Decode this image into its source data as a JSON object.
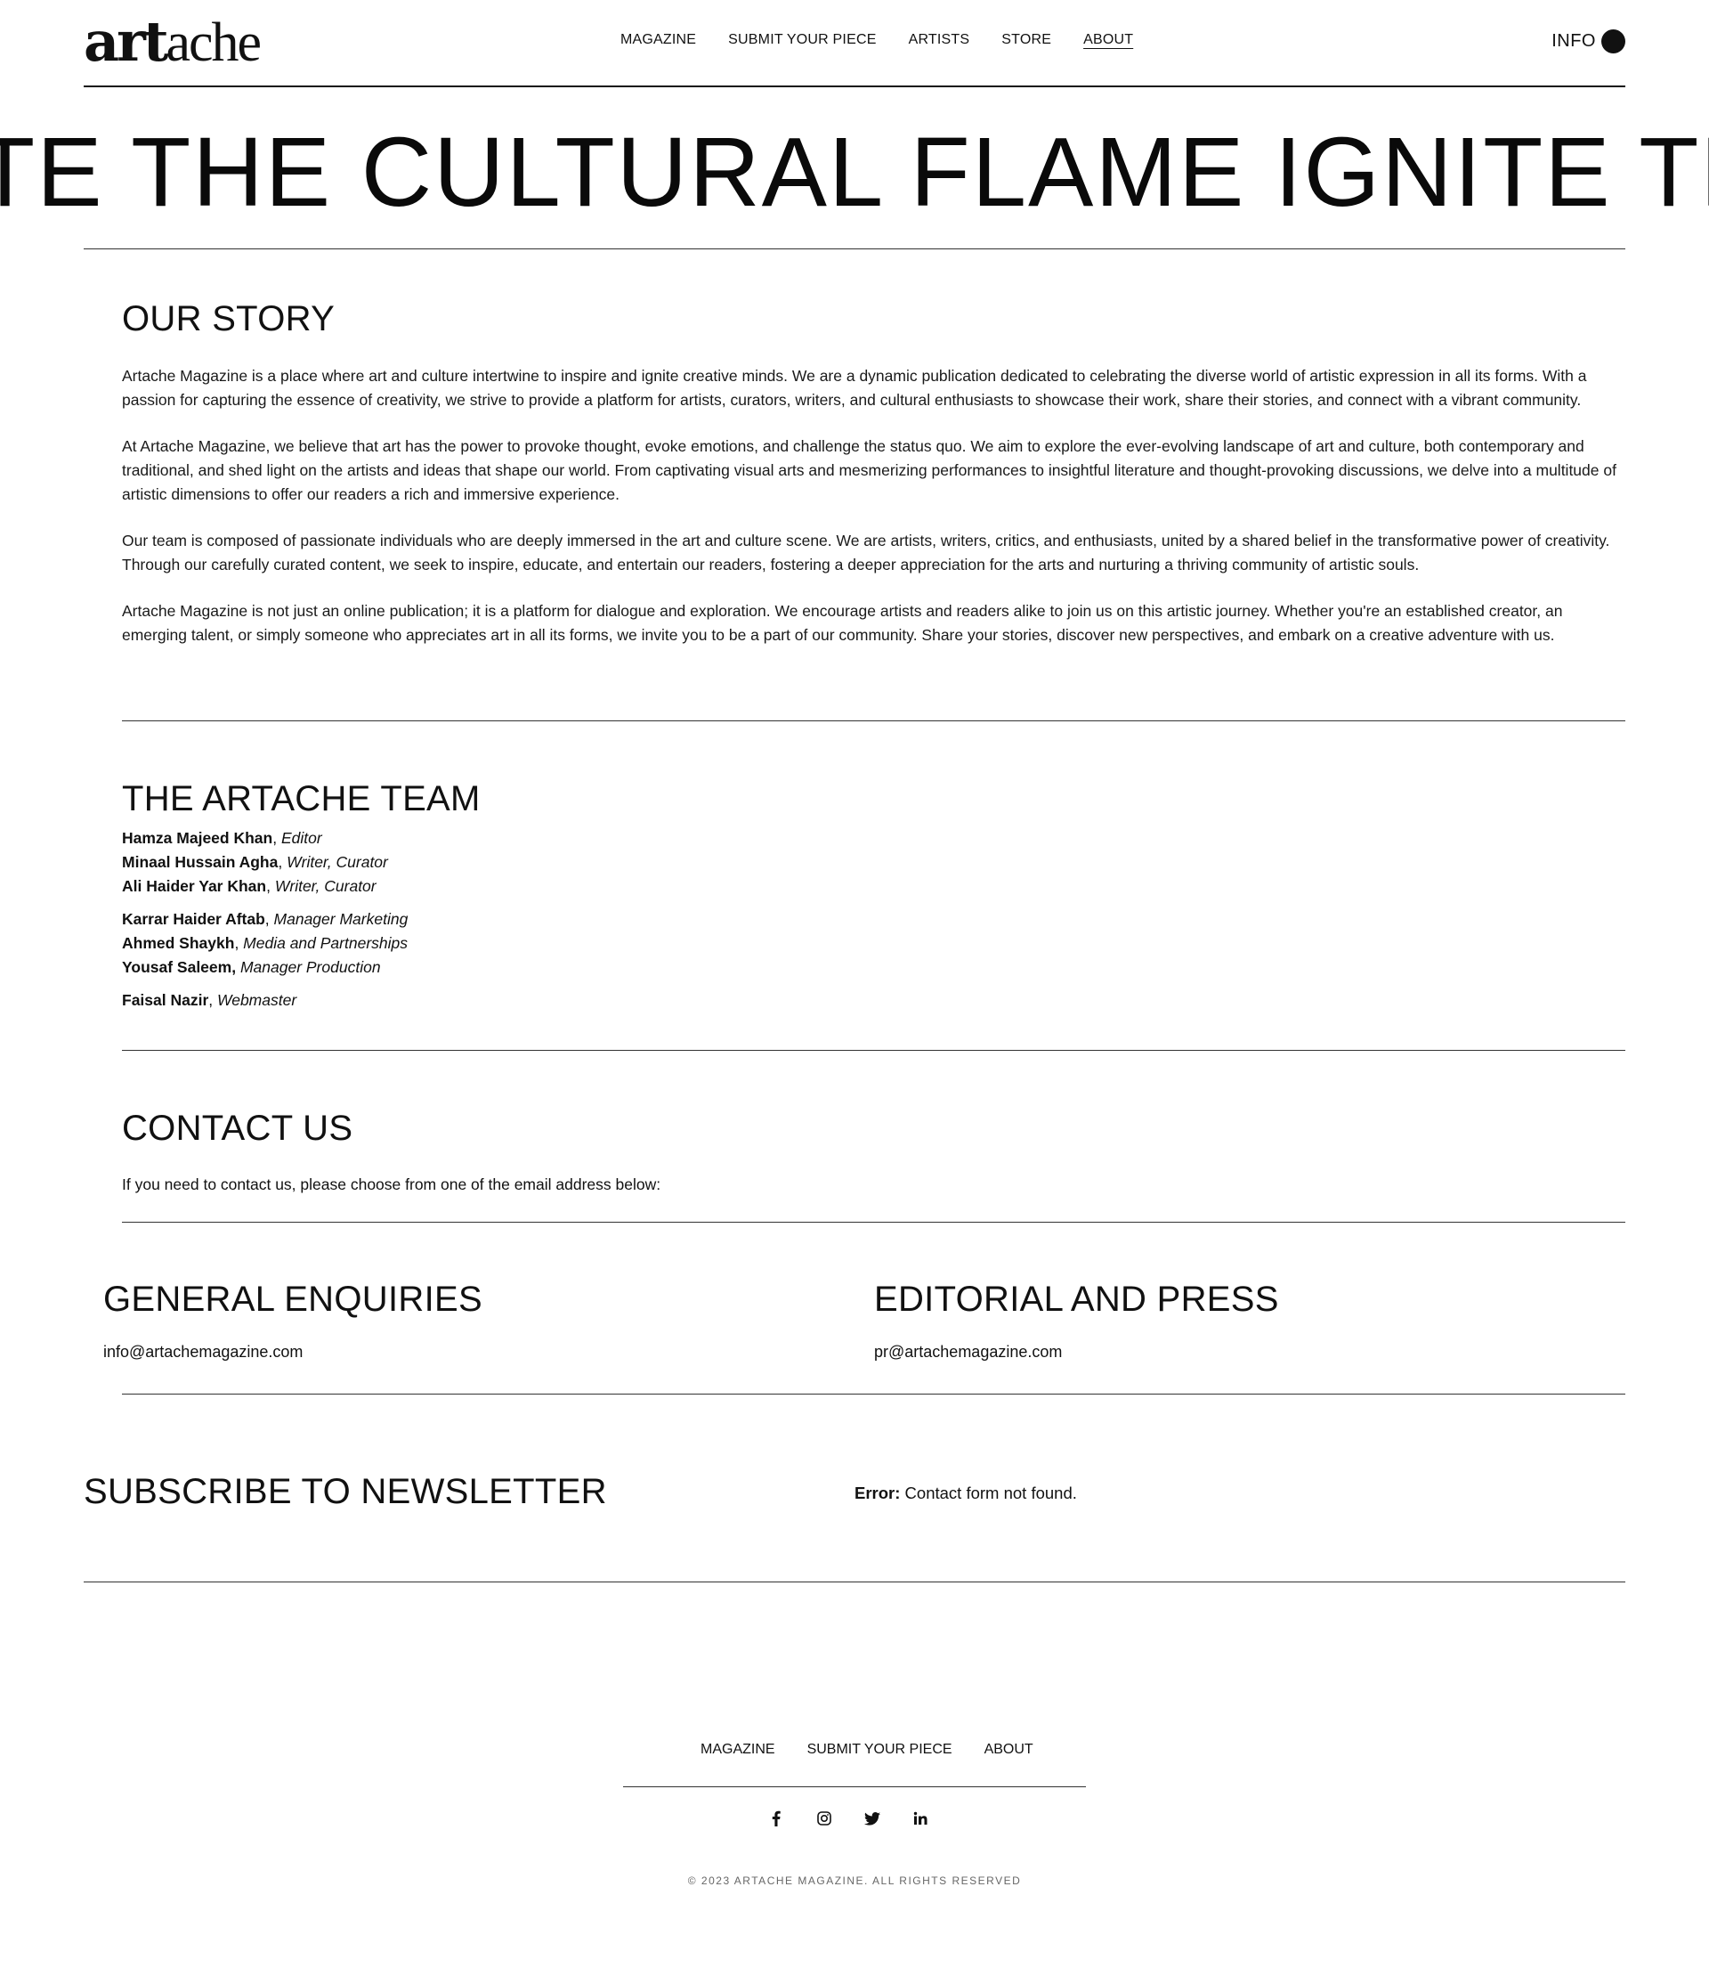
{
  "header": {
    "logo": {
      "part1": "art",
      "part2": "ache"
    },
    "nav": [
      {
        "label": "MAGAZINE"
      },
      {
        "label": "SUBMIT YOUR PIECE"
      },
      {
        "label": "ARTISTS"
      },
      {
        "label": "STORE"
      },
      {
        "label": "ABOUT",
        "active": true
      }
    ],
    "info_label": "INFO"
  },
  "marquee": {
    "text": "TE THE CULTURAL FLAME IGNITE THE A"
  },
  "story": {
    "title": "OUR STORY",
    "paragraphs": [
      "Artache Magazine is a place where art and culture intertwine to inspire and ignite creative minds. We are a dynamic publication dedicated to celebrating the diverse world of artistic expression in all its forms. With a passion for capturing the essence of creativity, we strive to provide a platform for artists, curators, writers, and cultural enthusiasts to showcase their work, share their stories, and connect with a vibrant community.",
      "At Artache Magazine, we believe that art has the power to provoke thought, evoke emotions, and challenge the status quo. We aim to explore the ever-evolving landscape of art and culture, both contemporary and traditional, and shed light on the artists and ideas that shape our world. From captivating visual arts and mesmerizing performances to insightful literature and thought-provoking discussions, we delve into a multitude of artistic dimensions to offer our readers a rich and immersive experience.",
      "Our team is composed of passionate individuals who are deeply immersed in the art and culture scene. We are artists, writers, critics, and enthusiasts, united by a shared belief in the transformative power of creativity. Through our carefully curated content, we seek to inspire, educate, and entertain our readers, fostering a deeper appreciation for the arts and nurturing a thriving community of artistic souls.",
      "Artache Magazine is not just an online publication; it is a platform for dialogue and exploration. We encourage artists and readers alike to join us on this artistic journey. Whether you're an established creator, an emerging talent, or simply someone who appreciates art in all its forms, we invite you to be a part of our community. Share your stories, discover new perspectives, and embark on a creative adventure with us."
    ]
  },
  "team": {
    "title": "THE ARTACHE TEAM",
    "groups": [
      [
        {
          "name": "Hamza Majeed Khan",
          "sep": ", ",
          "role": "Editor"
        },
        {
          "name": "Minaal Hussain Agha",
          "sep": ", ",
          "role": "Writer, Curator"
        },
        {
          "name": "Ali Haider Yar Khan",
          "sep": ", ",
          "role": "Writer, Curator"
        }
      ],
      [
        {
          "name": "Karrar Haider Aftab",
          "sep": ", ",
          "role": "Manager Marketing"
        },
        {
          "name": "Ahmed Shaykh",
          "sep": ", ",
          "role": "Media and Partnerships"
        },
        {
          "name": "Yousaf Saleem,",
          "sep": " ",
          "role": "Manager Production"
        }
      ],
      [
        {
          "name": "Faisal Nazir",
          "sep": ", ",
          "role": "Webmaster"
        }
      ]
    ]
  },
  "contact": {
    "title": "CONTACT US",
    "text": "If you need to contact us, please choose from one of the email address below:"
  },
  "general": {
    "title": "GENERAL ENQUIRIES",
    "email": "info@artachemagazine.com"
  },
  "editorial": {
    "title": "EDITORIAL AND PRESS",
    "email": "pr@artachemagazine.com"
  },
  "subscribe": {
    "title": "SUBSCRIBE TO NEWSLETTER",
    "error_label": "Error:",
    "error_text": " Contact form not found."
  },
  "footer": {
    "nav": [
      {
        "label": "MAGAZINE"
      },
      {
        "label": "SUBMIT YOUR PIECE"
      },
      {
        "label": "ABOUT"
      }
    ],
    "social": [
      "facebook-icon",
      "instagram-icon",
      "twitter-icon",
      "linkedin-icon"
    ],
    "copyright": "© 2023 ARTACHE MAGAZINE. ALL RIGHTS RESERVED"
  }
}
